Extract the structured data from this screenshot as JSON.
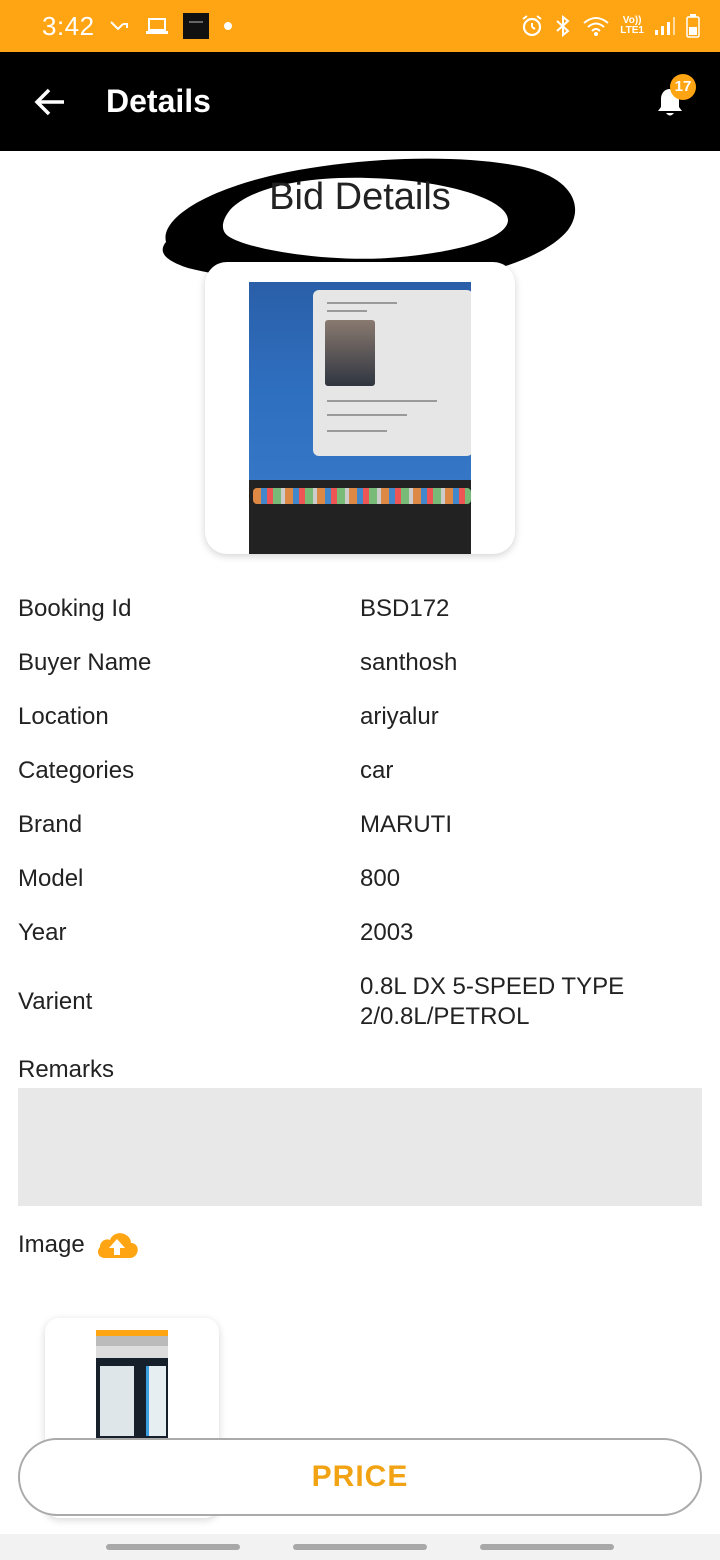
{
  "status_bar": {
    "time": "3:42",
    "network_text_top": "Vo))",
    "network_text_bottom": "LTE1"
  },
  "app_bar": {
    "title": "Details",
    "notification_count": "17"
  },
  "section": {
    "title": "Bid Details"
  },
  "details": [
    {
      "label": "Booking Id",
      "value": "BSD172"
    },
    {
      "label": "Buyer Name",
      "value": "santhosh"
    },
    {
      "label": "Location",
      "value": "ariyalur"
    },
    {
      "label": "Categories",
      "value": "car"
    },
    {
      "label": "Brand",
      "value": "MARUTI"
    },
    {
      "label": "Model",
      "value": "800"
    },
    {
      "label": "Year",
      "value": "2003"
    },
    {
      "label": "Varient",
      "value": "0.8L DX 5-SPEED TYPE 2/0.8L/PETROL"
    }
  ],
  "remarks": {
    "label": "Remarks",
    "value": ""
  },
  "image_section": {
    "label": "Image"
  },
  "price_button": {
    "label": "PRICE"
  },
  "colors": {
    "accent": "#FFA412",
    "app_bar": "#000000",
    "price_text": "#F2A313",
    "remarks_bg": "#E8E8E8"
  }
}
